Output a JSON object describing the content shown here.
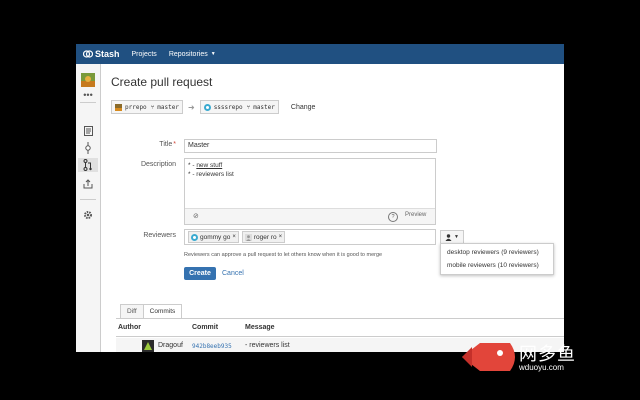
{
  "app": {
    "logo_text": "Stash",
    "nav": [
      {
        "label": "Projects"
      },
      {
        "label": "Repositories"
      }
    ]
  },
  "sidebar": {
    "icons": [
      "repo-avatar",
      "more-icon",
      "source-icon",
      "commits-icon",
      "pull-requests-icon",
      "fork-icon",
      "settings-icon"
    ]
  },
  "page": {
    "title": "Create pull request",
    "source": {
      "repo": "prrepo",
      "branch": "master"
    },
    "target": {
      "repo": "ssssrepo",
      "branch": "master"
    },
    "change_label": "Change"
  },
  "form": {
    "title_label": "Title",
    "title_value": "Master",
    "description_label": "Description",
    "description_lines": [
      "* - new stuff",
      "* - reviewers list"
    ],
    "preview_label": "Preview",
    "reviewers_label": "Reviewers",
    "reviewers": [
      {
        "name": "gommy go"
      },
      {
        "name": "roger ro"
      }
    ],
    "reviewer_hint": "Reviewers can approve a pull request to let others know when it is good to merge",
    "create_label": "Create",
    "cancel_label": "Cancel"
  },
  "reviewer_groups": [
    "desktop reviewers (9 reviewers)",
    "mobile reviewers (10 reviewers)"
  ],
  "tabs": [
    {
      "label": "Diff",
      "active": false
    },
    {
      "label": "Commits",
      "active": true
    }
  ],
  "commits": {
    "columns": [
      "Author",
      "Commit",
      "Message"
    ],
    "rows": [
      {
        "author": "Dragouf",
        "commit": "942b8eeb935",
        "message": "- reviewers list"
      }
    ]
  },
  "watermark": {
    "brand": "网多鱼",
    "site": "wduoyu.com"
  },
  "colors": {
    "header": "#205081",
    "primary": "#3572b0",
    "required": "#d04437"
  }
}
